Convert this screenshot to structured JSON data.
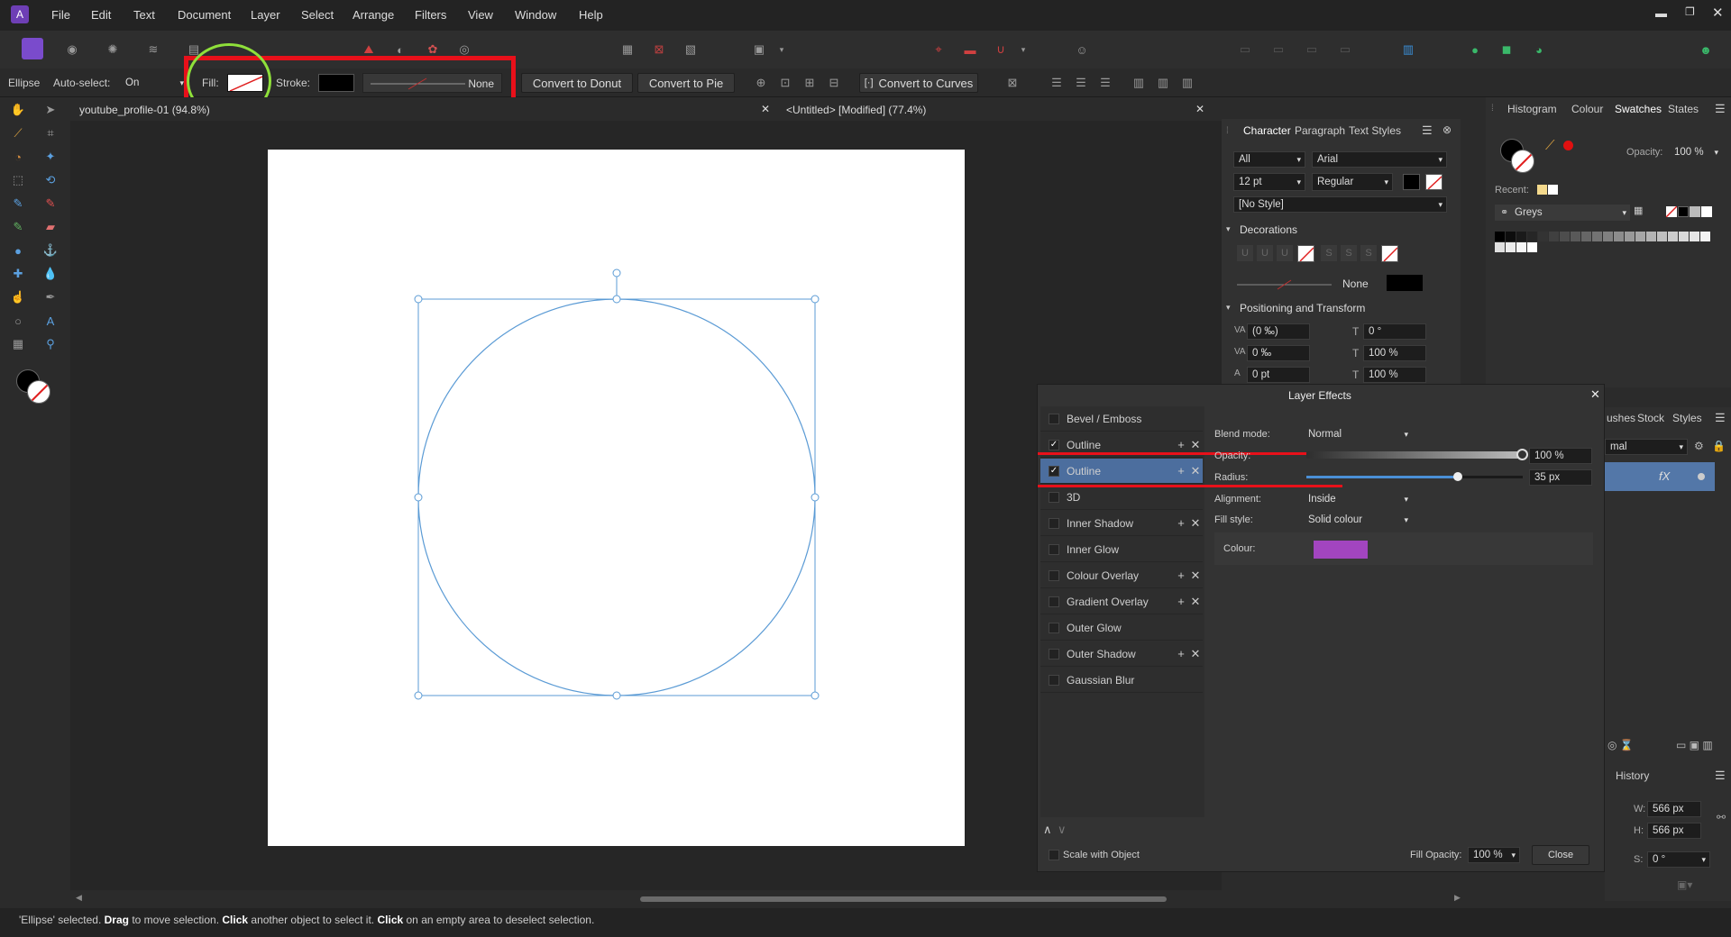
{
  "menu": [
    "File",
    "Edit",
    "Text",
    "Document",
    "Layer",
    "Select",
    "Arrange",
    "Filters",
    "View",
    "Window",
    "Help"
  ],
  "context": {
    "tool": "Ellipse",
    "auto_select_label": "Auto-select:",
    "auto_select_value": "On",
    "fill_label": "Fill:",
    "stroke_label": "Stroke:",
    "stroke_style": "None",
    "convert_donut": "Convert to Donut",
    "convert_pie": "Convert to Pie",
    "convert_curves": "Convert to Curves"
  },
  "tabs": {
    "doc1": "youtube_profile-01 (94.8%)",
    "doc2": "<Untitled> [Modified] (77.4%)"
  },
  "character": {
    "tabs": [
      "Character",
      "Paragraph",
      "Text Styles"
    ],
    "scope": "All",
    "font": "Arial",
    "size": "12 pt",
    "weight": "Regular",
    "style": "[No Style]",
    "decorations": "Decorations",
    "deco_none": "None",
    "positioning": "Positioning and Transform",
    "kern": "(0 ‰)",
    "rotate": "0 °",
    "track": "0 ‰",
    "vscale": "100 %",
    "baseline": "0 pt",
    "hscale": "100 %"
  },
  "right_tabs": [
    "Histogram",
    "Colour",
    "Swatches",
    "States"
  ],
  "swatches": {
    "opacity_label": "Opacity:",
    "opacity": "100 %",
    "recent_label": "Recent:",
    "palette": "Greys"
  },
  "layers_tabs": [
    "ushes",
    "Stock",
    "Styles"
  ],
  "layers_blend": "mal",
  "history_tab": "History",
  "transform": {
    "w_label": "W:",
    "w": "566 px",
    "h_label": "H:",
    "h": "566 px",
    "s_label": "S:",
    "s": "0 °"
  },
  "effects": {
    "title": "Layer Effects",
    "items": [
      {
        "name": "Bevel / Emboss",
        "checked": false,
        "plus": false
      },
      {
        "name": "Outline",
        "checked": true,
        "plus": true
      },
      {
        "name": "Outline",
        "checked": true,
        "plus": true,
        "selected": true
      },
      {
        "name": "3D",
        "checked": false,
        "plus": false
      },
      {
        "name": "Inner Shadow",
        "checked": false,
        "plus": true
      },
      {
        "name": "Inner Glow",
        "checked": false,
        "plus": false
      },
      {
        "name": "Colour Overlay",
        "checked": false,
        "plus": true
      },
      {
        "name": "Gradient Overlay",
        "checked": false,
        "plus": true
      },
      {
        "name": "Outer Glow",
        "checked": false,
        "plus": false
      },
      {
        "name": "Outer Shadow",
        "checked": false,
        "plus": true
      },
      {
        "name": "Gaussian Blur",
        "checked": false,
        "plus": false
      }
    ],
    "blend_label": "Blend mode:",
    "blend": "Normal",
    "opacity_label": "Opacity:",
    "opacity": "100 %",
    "opacity_level": 1.0,
    "radius_label": "Radius:",
    "radius": "35 px",
    "radius_level": 0.7,
    "align_label": "Alignment:",
    "align": "Inside",
    "fillstyle_label": "Fill style:",
    "fillstyle": "Solid colour",
    "colour_label": "Colour:",
    "colour": "#a245bf",
    "scale_label": "Scale with Object",
    "fill_opacity_label": "Fill Opacity:",
    "fill_opacity": "100 %",
    "close": "Close"
  },
  "status": {
    "sel": "'Ellipse' selected. ",
    "d1": "Drag",
    "t1": " to move selection. ",
    "d2": "Click",
    "t2": " another object to select it. ",
    "d3": "Click",
    "t3": " on an empty area to deselect selection."
  },
  "colors": {
    "accent": "#4a8fd6",
    "annotation_red": "#e8101a",
    "annotation_green": "#8fe03a",
    "selection": "#5b9bd5"
  }
}
